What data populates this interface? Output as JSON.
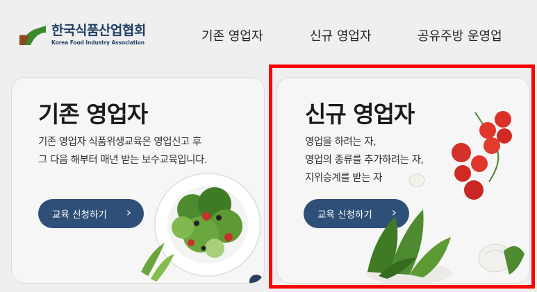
{
  "header": {
    "logo": {
      "name_ko": "한국식품산업협회",
      "name_en": "Korea Food Industry Association"
    },
    "nav": [
      {
        "label": "기존 영업자"
      },
      {
        "label": "신규 영업자"
      },
      {
        "label": "공유주방 운영업"
      }
    ]
  },
  "cards": [
    {
      "title": "기존 영업자",
      "desc_lines": [
        "기존 영업자 식품위생교육은 영업신고 후",
        "그 다음 해부터 매년 받는 보수교육입니다."
      ],
      "button_label": "교육 신청하기",
      "button_icon": "chevron-right-icon"
    },
    {
      "title": "신규 영업자",
      "desc_lines": [
        "영업을 하려는 자,",
        "영업의 종류를 추가하려는 자,",
        "지위승계를 받는 자"
      ],
      "button_label": "교육 신청하기",
      "button_icon": "chevron-right-icon"
    }
  ],
  "colors": {
    "brand_navy": "#1f3f66",
    "button_bg": "#2e4f78",
    "logo_green": "#3a8a2a",
    "logo_brown": "#8a4a1e",
    "highlight": "#ff0000"
  }
}
